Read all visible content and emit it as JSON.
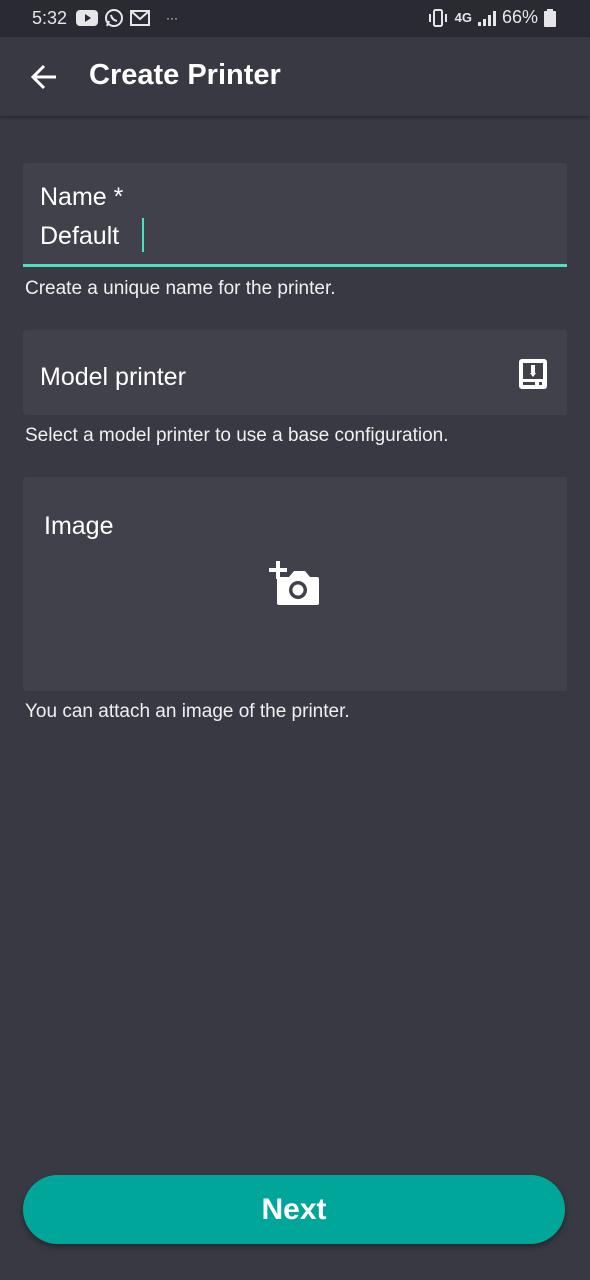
{
  "status_bar": {
    "time": "5:32",
    "notification_icons": [
      "youtube-icon",
      "whatsapp-icon",
      "gmail-icon",
      "more-dots-icon"
    ],
    "more": "···",
    "network": "4G",
    "battery": "66%"
  },
  "app_bar": {
    "title": "Create Printer",
    "back_icon": "arrow-back-icon"
  },
  "form": {
    "name": {
      "label": "Name *",
      "value": "Default",
      "helper": "Create a unique name for the printer."
    },
    "model": {
      "label": "Model printer",
      "icon": "printer-3d-icon",
      "helper": "Select a model printer to use a base configuration."
    },
    "image": {
      "label": "Image",
      "icon": "add-photo-icon",
      "helper": "You can attach an image of the printer."
    }
  },
  "footer": {
    "next_label": "Next"
  },
  "colors": {
    "background": "#393943",
    "field": "#41414b",
    "accent": "#4ee0c1",
    "button": "#00a699"
  }
}
